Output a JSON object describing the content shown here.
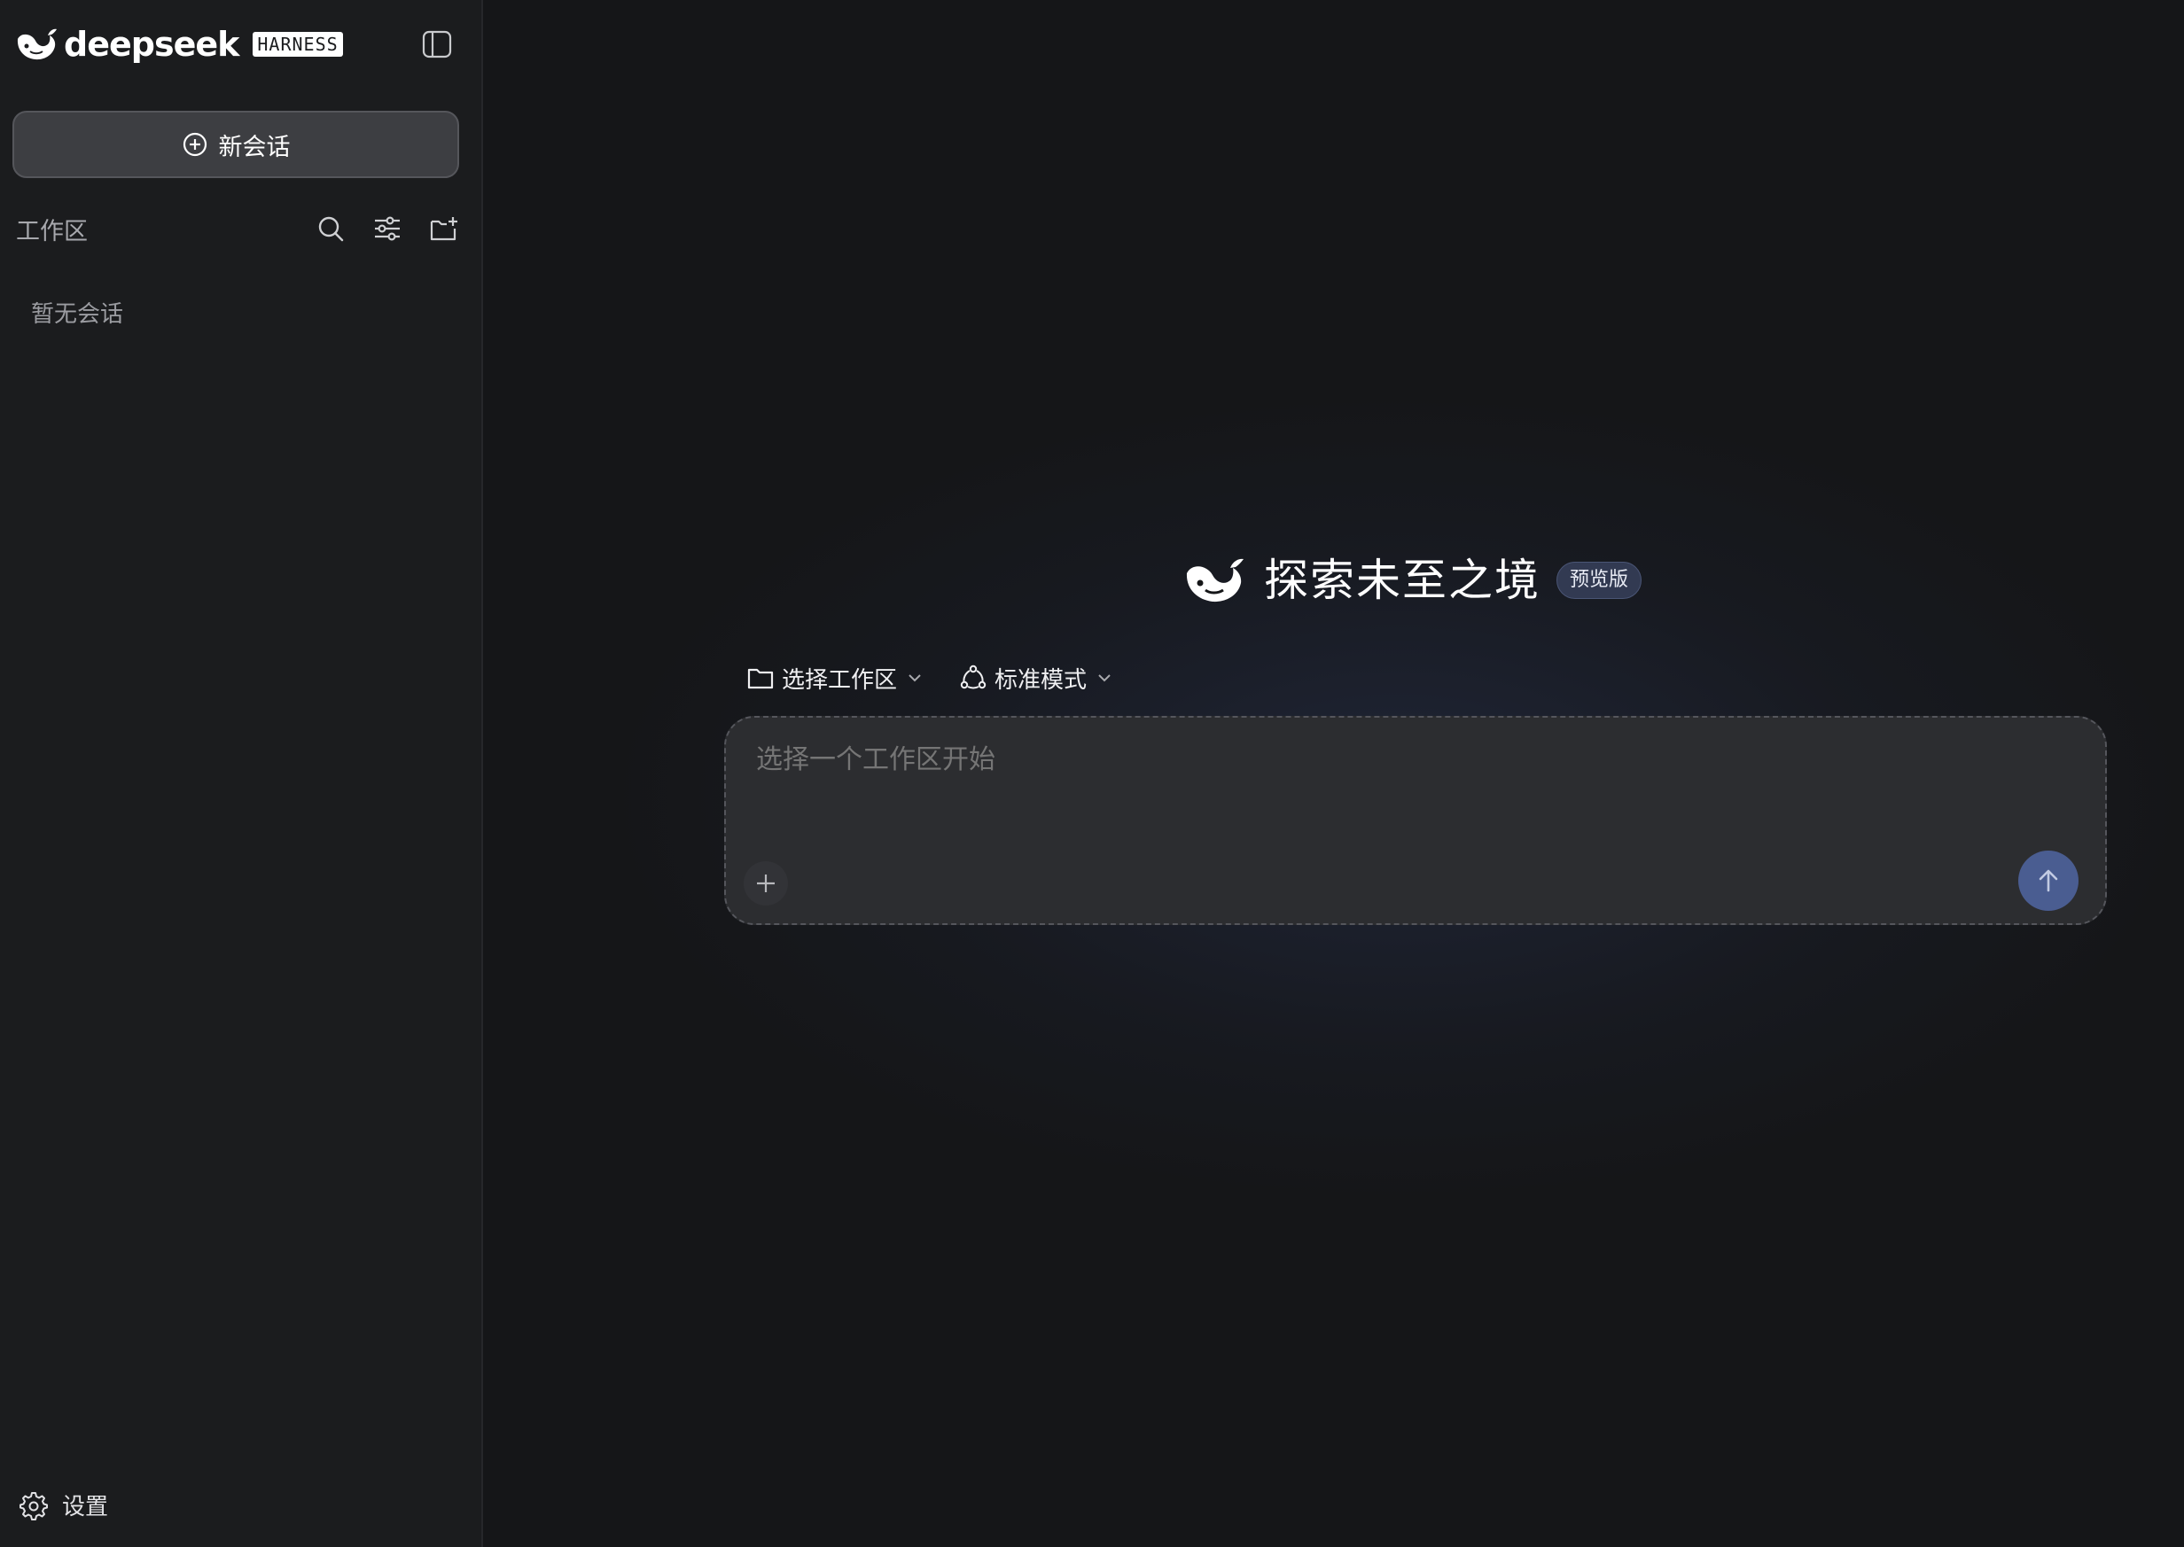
{
  "brand": {
    "name": "deepseek",
    "badge": "HARNESS"
  },
  "sidebar": {
    "new_chat_label": "新会话",
    "workspace_label": "工作区",
    "empty_label": "暂无会话",
    "settings_label": "设置",
    "icons": [
      "sidebar-toggle-icon",
      "plus-circle-icon",
      "search-icon",
      "sliders-icon",
      "folder-plus-icon",
      "gear-icon"
    ]
  },
  "main": {
    "hero_title": "探索未至之境",
    "hero_badge": "预览版",
    "workspace_selector": "选择工作区",
    "mode_selector": "标准模式",
    "composer_placeholder": "选择一个工作区开始",
    "icons": [
      "whale-logo-icon",
      "folder-icon",
      "chevron-down-icon",
      "mode-cycle-icon",
      "plus-icon",
      "arrow-up-icon"
    ]
  },
  "colors": {
    "background": "#151618",
    "sidebar": "#1b1c1e",
    "send_button": "#4a5d91",
    "badge": "#323a52"
  }
}
